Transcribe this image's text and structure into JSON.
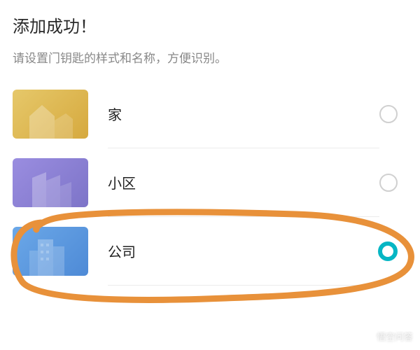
{
  "header": {
    "title": "添加成功！",
    "subtitle": "请设置门钥匙的样式和名称，方便识别。"
  },
  "options": [
    {
      "id": "home",
      "label": "家",
      "card_color_start": "#e6c86a",
      "card_color_end": "#d6a93e",
      "selected": false
    },
    {
      "id": "community",
      "label": "小区",
      "card_color_start": "#9a8de0",
      "card_color_end": "#7d74c8",
      "selected": false
    },
    {
      "id": "company",
      "label": "公司",
      "card_color_start": "#6ba8e8",
      "card_color_end": "#4e8ad6",
      "selected": true
    }
  ],
  "annotation": {
    "stroke": "#e8913a",
    "highlights_option": "company"
  },
  "watermark": {
    "text": "悟空问答"
  }
}
